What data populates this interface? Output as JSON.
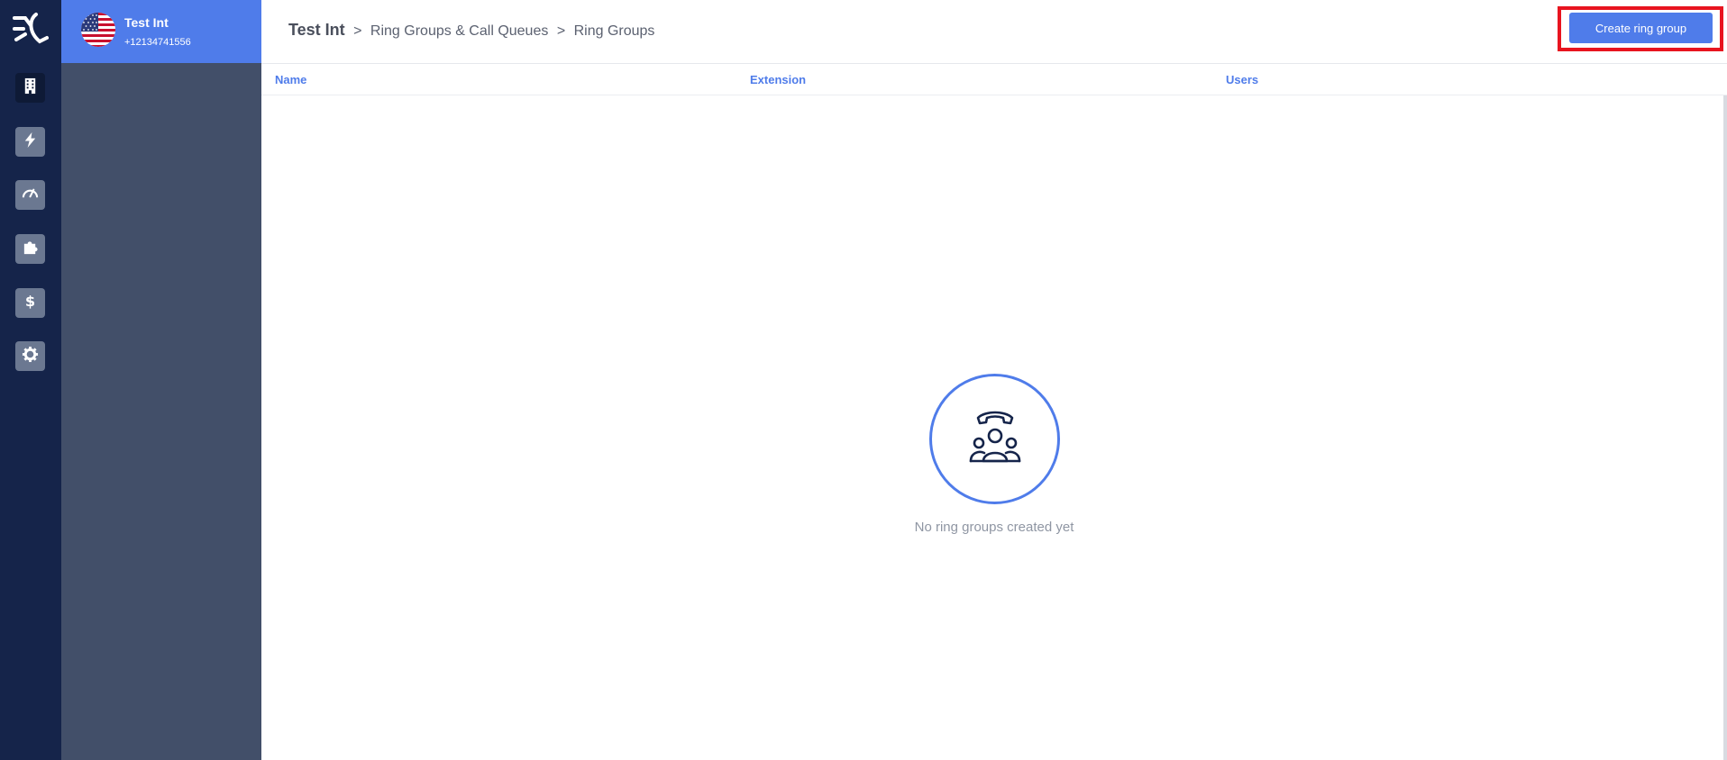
{
  "account": {
    "name": "Test Int",
    "phone": "+12134741556"
  },
  "breadcrumb": {
    "root": "Test Int",
    "separator": ">",
    "section": "Ring Groups & Call Queues",
    "page": "Ring Groups"
  },
  "actions": {
    "create_label": "Create ring group"
  },
  "table": {
    "columns": [
      "Name",
      "Extension",
      "Users"
    ]
  },
  "empty_state": {
    "message": "No ring groups created yet"
  },
  "nav": {
    "items": [
      "building-icon",
      "bolt-icon",
      "gauge-icon",
      "puzzle-icon",
      "dollar-icon",
      "gear-icon"
    ],
    "active": "building-icon"
  },
  "colors": {
    "rail": "#15244a",
    "panel": "#424f69",
    "accent": "#4f7cea",
    "highlight": "#e8141f"
  }
}
